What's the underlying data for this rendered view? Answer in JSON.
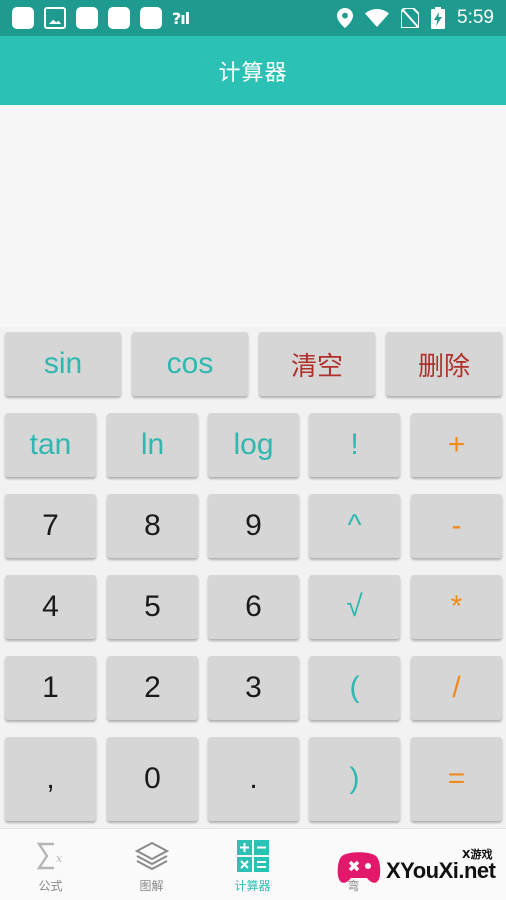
{
  "status_bar": {
    "signal_text": "?ıl",
    "time": "5:59"
  },
  "header": {
    "title": "计算器"
  },
  "keypad": {
    "row1": [
      "sin",
      "cos",
      "清空",
      "删除"
    ],
    "row2": [
      "tan",
      "ln",
      "log",
      "!",
      "+"
    ],
    "row3": [
      "7",
      "8",
      "9",
      "^",
      "-"
    ],
    "row4": [
      "4",
      "5",
      "6",
      "√",
      "*"
    ],
    "row5": [
      "1",
      "2",
      "3",
      "(",
      "/"
    ],
    "row6": [
      ",",
      "0",
      ".",
      ")",
      "="
    ]
  },
  "bottom_nav": {
    "items": [
      {
        "label": "公式",
        "icon": "sigma-icon"
      },
      {
        "label": "图解",
        "icon": "layers-icon"
      },
      {
        "label": "计算器",
        "icon": "calculator-icon",
        "active": true
      },
      {
        "label": "弯",
        "icon": "hidden-icon"
      }
    ]
  },
  "watermark": {
    "small_text": "X游戏",
    "big_text": "XYouXi.net"
  },
  "colors": {
    "status_bar": "#1e9a8f",
    "header": "#2cc1b5",
    "teal_key_text": "#2fb8b0",
    "orange_key_text": "#f28a1a",
    "red_key_text": "#b0302c",
    "key_bg": "#d6d6d6"
  }
}
